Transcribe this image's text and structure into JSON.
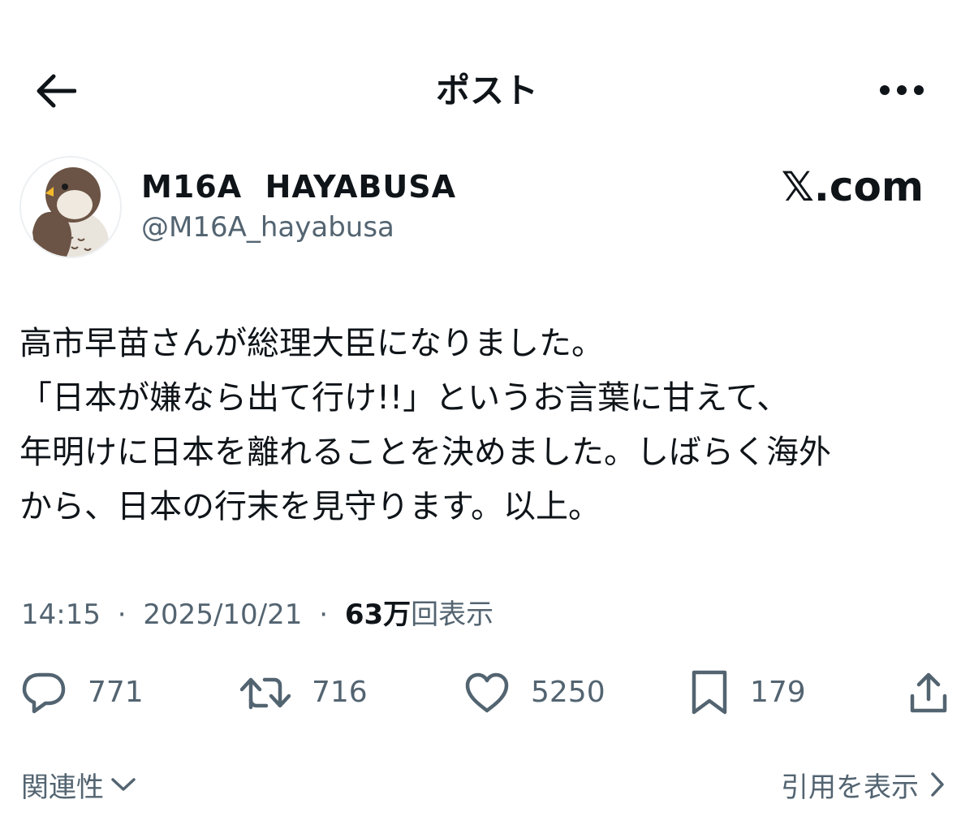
{
  "header": {
    "title": "ポスト",
    "back_icon": "arrow-left-icon",
    "more_icon": "more-dots-icon"
  },
  "author": {
    "name": "M16A  HAYABUSA",
    "handle": "@M16A_hayabusa",
    "avatar_icon": "falcon-avatar-icon"
  },
  "brand": "𝕏.com",
  "post": {
    "lines": [
      "高市早苗さんが総理大臣になりました。",
      "「日本が嫌なら出て行け!!」というお言葉に甘えて、",
      "年明けに日本を離れることを決めました。しばらく海外",
      "から、日本の行末を見守ります。以上。"
    ]
  },
  "meta": {
    "time": "14:15",
    "separator": "·",
    "date": "2025/10/21",
    "views_count": "63万",
    "views_label": "回表示"
  },
  "actions": {
    "reply": {
      "icon": "reply-bubble-icon",
      "count": "771"
    },
    "repost": {
      "icon": "repost-icon",
      "count": "716"
    },
    "like": {
      "icon": "heart-icon",
      "count": "5250"
    },
    "bookmark": {
      "icon": "bookmark-icon",
      "count": "179"
    },
    "share": {
      "icon": "share-icon"
    }
  },
  "footer": {
    "sort_label": "関連性",
    "quotes_label": "引用を表示"
  },
  "colors": {
    "text_primary": "#0f1419",
    "text_secondary": "#536471",
    "background": "#ffffff"
  }
}
